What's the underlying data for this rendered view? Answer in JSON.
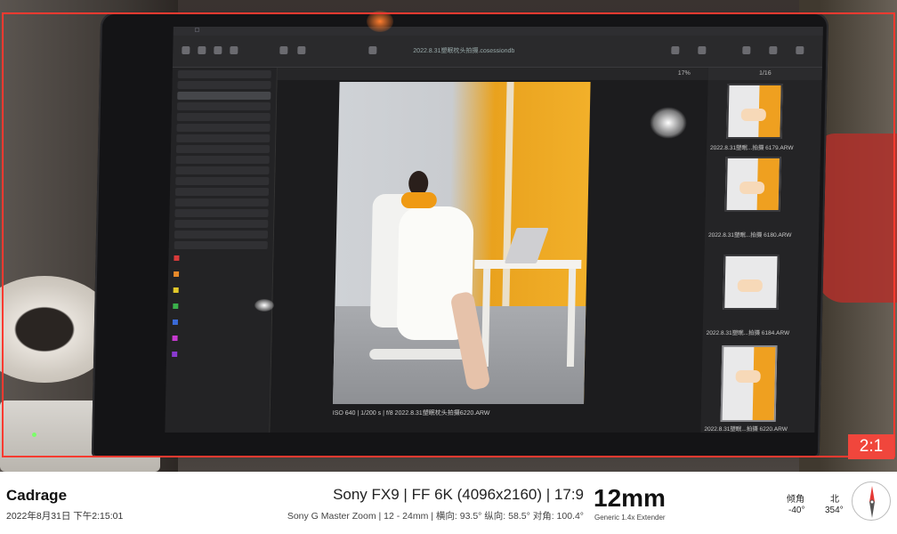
{
  "viewfinder": {
    "aspect_ratio_badge": "2:1",
    "frame_color": "#ff3a30"
  },
  "screen": {
    "document_title": "2022.8.31塑眠枕头拍摄.cosessiondb",
    "zoom": "17%",
    "thumb_counter": "1/16",
    "main_photo_caption": "ISO 640  |  1/200 s  |  f/8    2022.8.31塑眠枕头拍摄6220.ARW",
    "thumbnails": [
      {
        "caption": "2022.8.31塑眠...拍摄 6179.ARW"
      },
      {
        "caption": "2022.8.31塑眠...拍摄 6180.ARW"
      },
      {
        "caption": "2022.8.31塑眠...拍摄 6184.ARW"
      },
      {
        "caption": "2022.8.31塑眠...拍摄 6220.ARW"
      }
    ]
  },
  "footer": {
    "app_name": "Cadrage",
    "datetime": "2022年8月31日 下午2:15:01",
    "camera": "Sony FX9  |  FF 6K (4096x2160)  |  17:9",
    "lens": "Sony G Master Zoom  |  12 - 24mm  |  横向: 93.5°  纵向: 58.5°  对角: 100.4°",
    "focal_length": "12mm",
    "extender": "Generic 1.4x Extender",
    "tilt_label": "倾角",
    "tilt_value": "-40°",
    "heading_label": "北",
    "heading_value": "354°",
    "compass_icon": "compass-icon",
    "compass_needle_color": "#e53935"
  }
}
